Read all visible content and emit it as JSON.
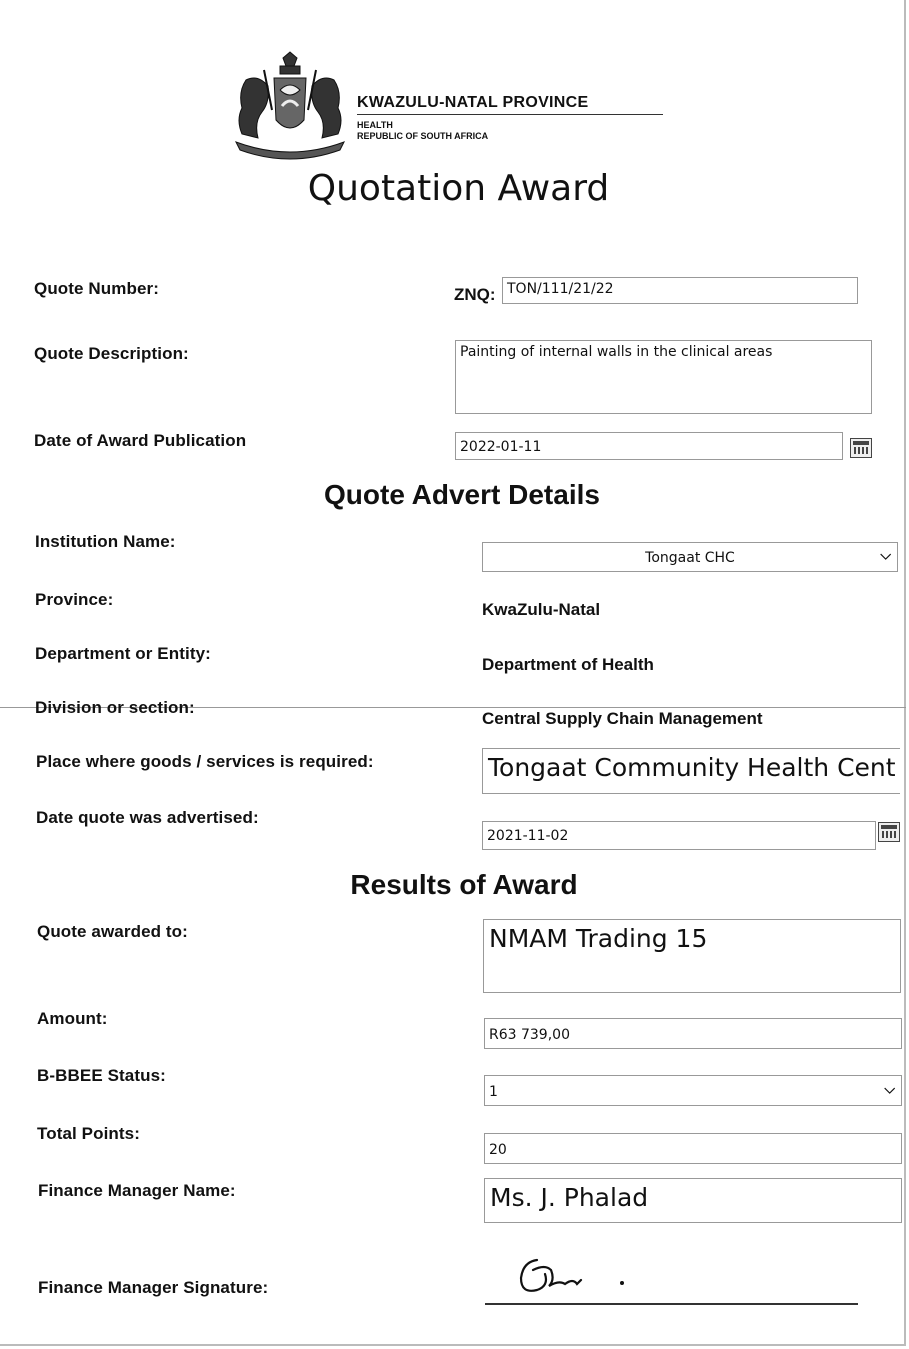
{
  "header": {
    "province": "KWAZULU-NATAL PROVINCE",
    "department": "HEALTH",
    "country": "REPUBLIC OF SOUTH AFRICA",
    "title": "Quotation Award"
  },
  "quote": {
    "number_label": "Quote Number:",
    "number_prefix": "ZNQ:",
    "number_value": "TON/111/21/22",
    "description_label": "Quote Description:",
    "description_value": "Painting of internal walls in the clinical areas",
    "award_date_label": "Date of Award Publication",
    "award_date_value": "2022-01-11"
  },
  "advert": {
    "heading": "Quote Advert Details",
    "institution_label": "Institution Name:",
    "institution_value": "Tongaat CHC",
    "province_label": "Province:",
    "province_value": "KwaZulu-Natal",
    "department_label": "Department or Entity:",
    "department_value": "Department of Health",
    "division_label": "Division or section:",
    "division_value": "Central Supply Chain Management",
    "place_label": "Place where goods /  services is required:",
    "place_value": "Tongaat Community Health Cent",
    "advertised_label": "Date quote was advertised:",
    "advertised_value": "2021-11-02"
  },
  "results": {
    "heading": "Results of Award",
    "awarded_label": "Quote awarded to:",
    "awarded_value": "NMAM Trading 15",
    "amount_label": "Amount:",
    "amount_value": "R63 739,00",
    "bbbee_label": "B-BBEE Status:",
    "bbbee_value": "1",
    "points_label": "Total Points:",
    "points_value": "20",
    "manager_label": "Finance Manager Name:",
    "manager_value": "Ms. J. Phalad",
    "signature_label": "Finance Manager Signature:"
  }
}
